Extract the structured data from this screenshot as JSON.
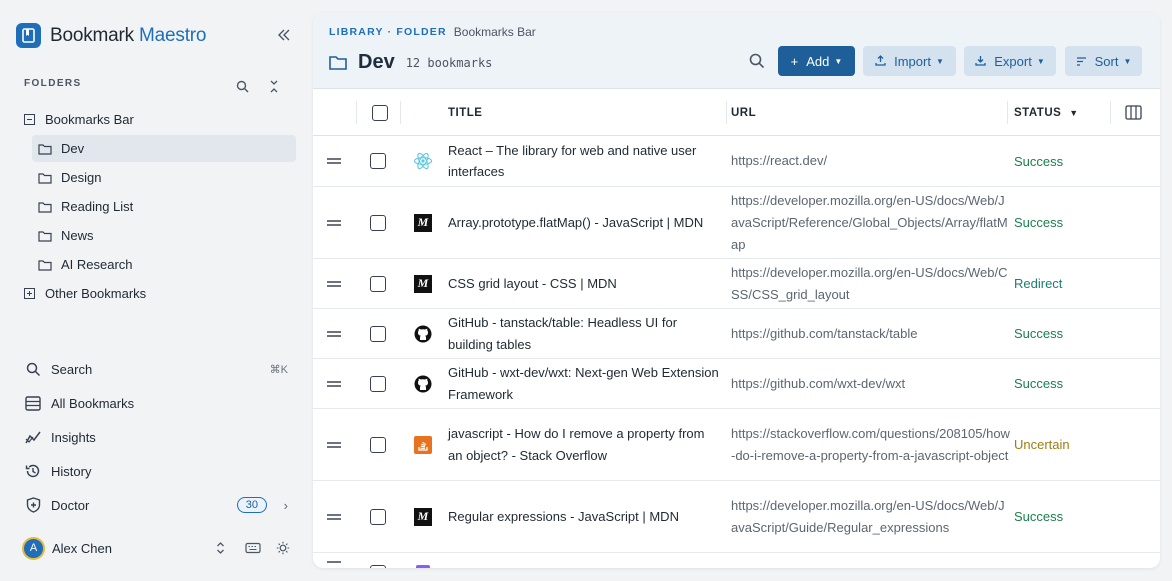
{
  "brand": {
    "name_main": "Bookmark",
    "name_accent": "Maestro"
  },
  "sidebar": {
    "folders_label": "FOLDERS",
    "tree": [
      {
        "label": "Bookmarks Bar"
      },
      {
        "label": "Dev"
      },
      {
        "label": "Design"
      },
      {
        "label": "Reading List"
      },
      {
        "label": "News"
      },
      {
        "label": "AI Research"
      },
      {
        "label": "Other Bookmarks"
      }
    ],
    "nav": [
      {
        "label": "Search",
        "shortcut": "⌘K"
      },
      {
        "label": "All Bookmarks"
      },
      {
        "label": "Insights"
      },
      {
        "label": "History"
      },
      {
        "label": "Doctor",
        "badge": "30"
      }
    ],
    "user": {
      "initial": "A",
      "name": "Alex Chen"
    }
  },
  "header": {
    "crumb_lib": "LIBRARY · FOLDER",
    "crumb_path": "Bookmarks Bar",
    "title": "Dev",
    "count": "12 bookmarks",
    "buttons": {
      "add": "Add",
      "import": "Import",
      "export": "Export",
      "sort": "Sort"
    }
  },
  "table": {
    "columns": {
      "title": "TITLE",
      "url": "URL",
      "status": "STATUS"
    },
    "rows": [
      {
        "title": "React – The library for web and native user interfaces",
        "url": "https://react.dev/",
        "status": "Success",
        "favicon": "react-icon"
      },
      {
        "title": "Array.prototype.flatMap() - JavaScript | MDN",
        "url": "https://developer.mozilla.org/en-US/docs/Web/JavaScript/Reference/Global_Objects/Array/flatMap",
        "status": "Success",
        "favicon": "mdn-icon"
      },
      {
        "title": "CSS grid layout - CSS | MDN",
        "url": "https://developer.mozilla.org/en-US/docs/Web/CSS/CSS_grid_layout",
        "status": "Redirect",
        "favicon": "mdn-icon"
      },
      {
        "title": "GitHub - tanstack/table: Headless UI for building tables",
        "url": "https://github.com/tanstack/table",
        "status": "Success",
        "favicon": "github-icon"
      },
      {
        "title": "GitHub - wxt-dev/wxt: Next-gen Web Extension Framework",
        "url": "https://github.com/wxt-dev/wxt",
        "status": "Success",
        "favicon": "github-icon"
      },
      {
        "title": "javascript - How do I remove a property from an object? - Stack Overflow",
        "url": "https://stackoverflow.com/questions/208105/how-do-i-remove-a-property-from-a-javascript-object",
        "status": "Uncertain",
        "favicon": "stackoverflow-icon"
      },
      {
        "title": "Regular expressions - JavaScript | MDN",
        "url": "https://developer.mozilla.org/en-US/docs/Web/JavaScript/Guide/Regular_expressions",
        "status": "Success",
        "favicon": "mdn-icon"
      }
    ]
  },
  "colors": {
    "accent": "#1f6fb8",
    "success": "#1a7f4b",
    "redirect": "#1a7f6f",
    "uncertain": "#a07d10"
  }
}
